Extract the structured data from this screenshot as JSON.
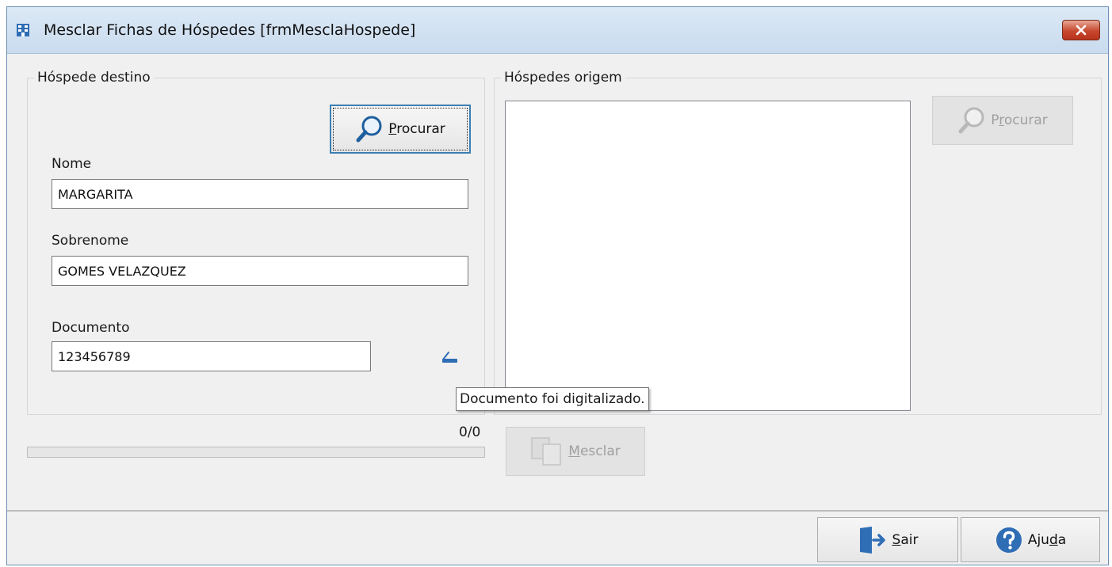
{
  "window": {
    "title": "Mesclar Fichas de Hóspedes [frmMesclaHospede]",
    "accent": "#c7472e"
  },
  "destino": {
    "legend": "Hóspede destino",
    "procurar_button": {
      "pre": "",
      "ul": "P",
      "post": "rocurar"
    },
    "nome_label": "Nome",
    "nome_value": "MARGARITA",
    "sobrenome_label": "Sobrenome",
    "sobrenome_value": "GOMES VELAZQUEZ",
    "documento_label": "Documento",
    "documento_value": "123456789",
    "scan_icon": "scanner-icon"
  },
  "origem": {
    "legend": "Hóspedes origem",
    "items": [],
    "procurar_button": {
      "pre": "P",
      "ul": "r",
      "post": "ocurar"
    }
  },
  "progress": {
    "label": "0/0",
    "fraction": 0
  },
  "mesclar_button": {
    "pre": "",
    "ul": "M",
    "post": "esclar"
  },
  "tooltip": "Documento foi digitalizado.",
  "footer": {
    "sair_button": {
      "pre": "",
      "ul": "S",
      "post": "air"
    },
    "ajuda_button": {
      "pre": "Aju",
      "ul": "d",
      "post": "a"
    }
  }
}
